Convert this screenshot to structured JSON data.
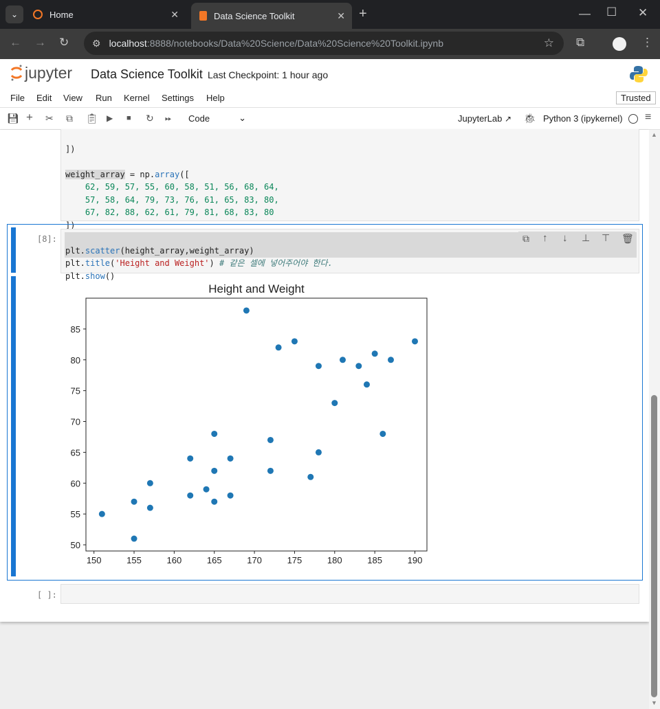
{
  "browser": {
    "tabs": [
      {
        "label": "Home"
      },
      {
        "label": "Data Science Toolkit"
      }
    ],
    "url_host": "localhost",
    "url_rest": ":8888/notebooks/Data%20Science/Data%20Science%20Toolkit.ipynb"
  },
  "jupyter": {
    "logo_text": "jupyter",
    "notebook_title": "Data Science Toolkit",
    "checkpoint": "Last Checkpoint: 1 hour ago",
    "menu": [
      "File",
      "Edit",
      "View",
      "Run",
      "Kernel",
      "Settings",
      "Help"
    ],
    "trusted": "Trusted",
    "cell_type": "Code",
    "jupyterlab_link": "JupyterLab",
    "kernel": "Python 3 (ipykernel)"
  },
  "cells": {
    "prev_close": "])",
    "weight_var": "weight_array",
    "weight_assign": " = np.",
    "weight_fn": "array",
    "weight_open": "([",
    "weight_row1": "62, 59, 57, 55, 60, 58, 51, 56, 68, 64,",
    "weight_row2": "57, 58, 64, 79, 73, 76, 61, 65, 83, 80,",
    "weight_row3": "67, 82, 88, 62, 61, 79, 81, 68, 83, 80",
    "weight_close": "])",
    "cell8_prompt": "[8]:",
    "cell8_line1_obj": "plt.",
    "cell8_line1_fn": "scatter",
    "cell8_line1_args": "(height_array,weight_array)",
    "cell8_line2_obj": "plt.",
    "cell8_line2_fn": "title",
    "cell8_line2_str": "'Height and Weight'",
    "cell8_line2_comment": "# 같은 셀에 넣어주어야 한다.",
    "cell8_line3_obj": "plt.",
    "cell8_line3_fn": "show",
    "cell8_line3_args": "()",
    "empty_prompt": "[ ]:"
  },
  "chart_data": {
    "type": "scatter",
    "title": "Height and Weight",
    "xlim": [
      149,
      191.5
    ],
    "ylim": [
      49,
      90
    ],
    "xticks": [
      150,
      155,
      160,
      165,
      170,
      175,
      180,
      185,
      190
    ],
    "yticks": [
      50,
      55,
      60,
      65,
      70,
      75,
      80,
      85
    ],
    "color": "#1f77b4",
    "points": [
      [
        151,
        55
      ],
      [
        155,
        57
      ],
      [
        155,
        51
      ],
      [
        157,
        60
      ],
      [
        157,
        56
      ],
      [
        162,
        64
      ],
      [
        162,
        58
      ],
      [
        164,
        59
      ],
      [
        165,
        68
      ],
      [
        165,
        62
      ],
      [
        165,
        57
      ],
      [
        167,
        64
      ],
      [
        167,
        58
      ],
      [
        169,
        88
      ],
      [
        172,
        67
      ],
      [
        172,
        62
      ],
      [
        173,
        82
      ],
      [
        175,
        83
      ],
      [
        177,
        61
      ],
      [
        178,
        79
      ],
      [
        178,
        65
      ],
      [
        180,
        73
      ],
      [
        181,
        80
      ],
      [
        183,
        79
      ],
      [
        184,
        76
      ],
      [
        185,
        81
      ],
      [
        186,
        68
      ],
      [
        187,
        80
      ],
      [
        190,
        83
      ]
    ]
  },
  "colors": {
    "accent": "#1976d2",
    "jupyter_orange": "#f37726"
  }
}
